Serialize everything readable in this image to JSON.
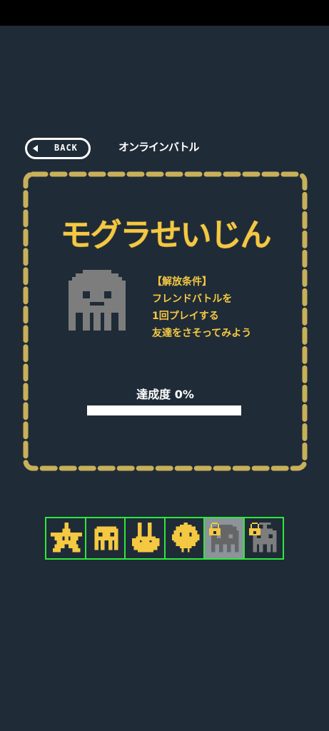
{
  "header": {
    "back_label": "BACK",
    "title": "オンラインバトル"
  },
  "panel": {
    "mode_title": "モグラせいじん",
    "condition_lines": [
      "【解放条件】",
      "フレンドバトルを",
      "1回プレイする",
      "友達をさそってみよう"
    ],
    "progress_label": "達成度 0%",
    "progress_value": 0
  },
  "characters": [
    {
      "icon": "star-icon",
      "locked": false,
      "selected": false
    },
    {
      "icon": "jellyfish-icon",
      "locked": false,
      "selected": false
    },
    {
      "icon": "rabbit-hand-icon",
      "locked": false,
      "selected": false
    },
    {
      "icon": "chick-icon",
      "locked": false,
      "selected": false
    },
    {
      "icon": "mole-alien-icon",
      "locked": true,
      "selected": true
    },
    {
      "icon": "antenna-alien-icon",
      "locked": true,
      "selected": false
    }
  ],
  "colors": {
    "background": "#1f2b37",
    "accent_yellow": "#f5c842",
    "dash_border": "#c8b05a",
    "tile_border": "#2ee83a",
    "locked_gray": "#7d7d7d"
  }
}
